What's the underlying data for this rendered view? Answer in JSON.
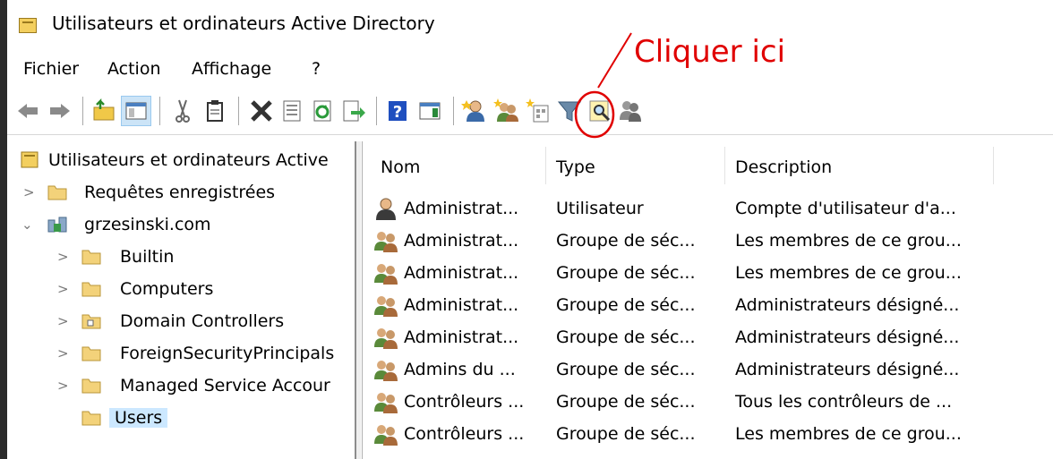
{
  "window": {
    "title": "Utilisateurs et ordinateurs Active Directory"
  },
  "menu": [
    "Fichier",
    "Action",
    "Affichage",
    "?"
  ],
  "annotation": {
    "text": "Cliquer ici",
    "color": "#e00000"
  },
  "toolbar": {
    "buttons": [
      "back-arrow-icon",
      "forward-arrow-icon",
      "up-folder-icon",
      "show-tree-icon",
      "cut-icon",
      "paste-icon",
      "delete-icon",
      "properties-icon",
      "refresh-icon",
      "export-list-icon",
      "help-icon",
      "action-pane-icon",
      "new-user-icon",
      "new-group-icon",
      "new-ou-icon",
      "filter-icon",
      "find-icon",
      "add-to-group-icon"
    ]
  },
  "tree": {
    "root": "Utilisateurs et ordinateurs Active",
    "saved_queries": "Requêtes enregistrées",
    "domain": "grzesinski.com",
    "children": [
      "Builtin",
      "Computers",
      "Domain Controllers",
      "ForeignSecurityPrincipals",
      "Managed Service Accour",
      "Users"
    ],
    "selected": "Users"
  },
  "list": {
    "columns": [
      "Nom",
      "Type",
      "Description"
    ],
    "rows": [
      {
        "name": "Administrat...",
        "type": "Utilisateur",
        "description": "Compte d'utilisateur d'a...",
        "icon": "user-icon"
      },
      {
        "name": "Administrat...",
        "type": "Groupe de séc...",
        "description": "Les membres de ce grou...",
        "icon": "group-icon"
      },
      {
        "name": "Administrat...",
        "type": "Groupe de séc...",
        "description": "Les membres de ce grou...",
        "icon": "group-icon"
      },
      {
        "name": "Administrat...",
        "type": "Groupe de séc...",
        "description": "Administrateurs désigné...",
        "icon": "group-icon"
      },
      {
        "name": "Administrat...",
        "type": "Groupe de séc...",
        "description": "Administrateurs désigné...",
        "icon": "group-icon"
      },
      {
        "name": "Admins du ...",
        "type": "Groupe de séc...",
        "description": "Administrateurs désigné...",
        "icon": "group-icon"
      },
      {
        "name": "Contrôleurs ...",
        "type": "Groupe de séc...",
        "description": "Tous les contrôleurs de ...",
        "icon": "group-icon"
      },
      {
        "name": "Contrôleurs ...",
        "type": "Groupe de séc...",
        "description": "Les membres de ce grou...",
        "icon": "group-icon"
      }
    ]
  }
}
